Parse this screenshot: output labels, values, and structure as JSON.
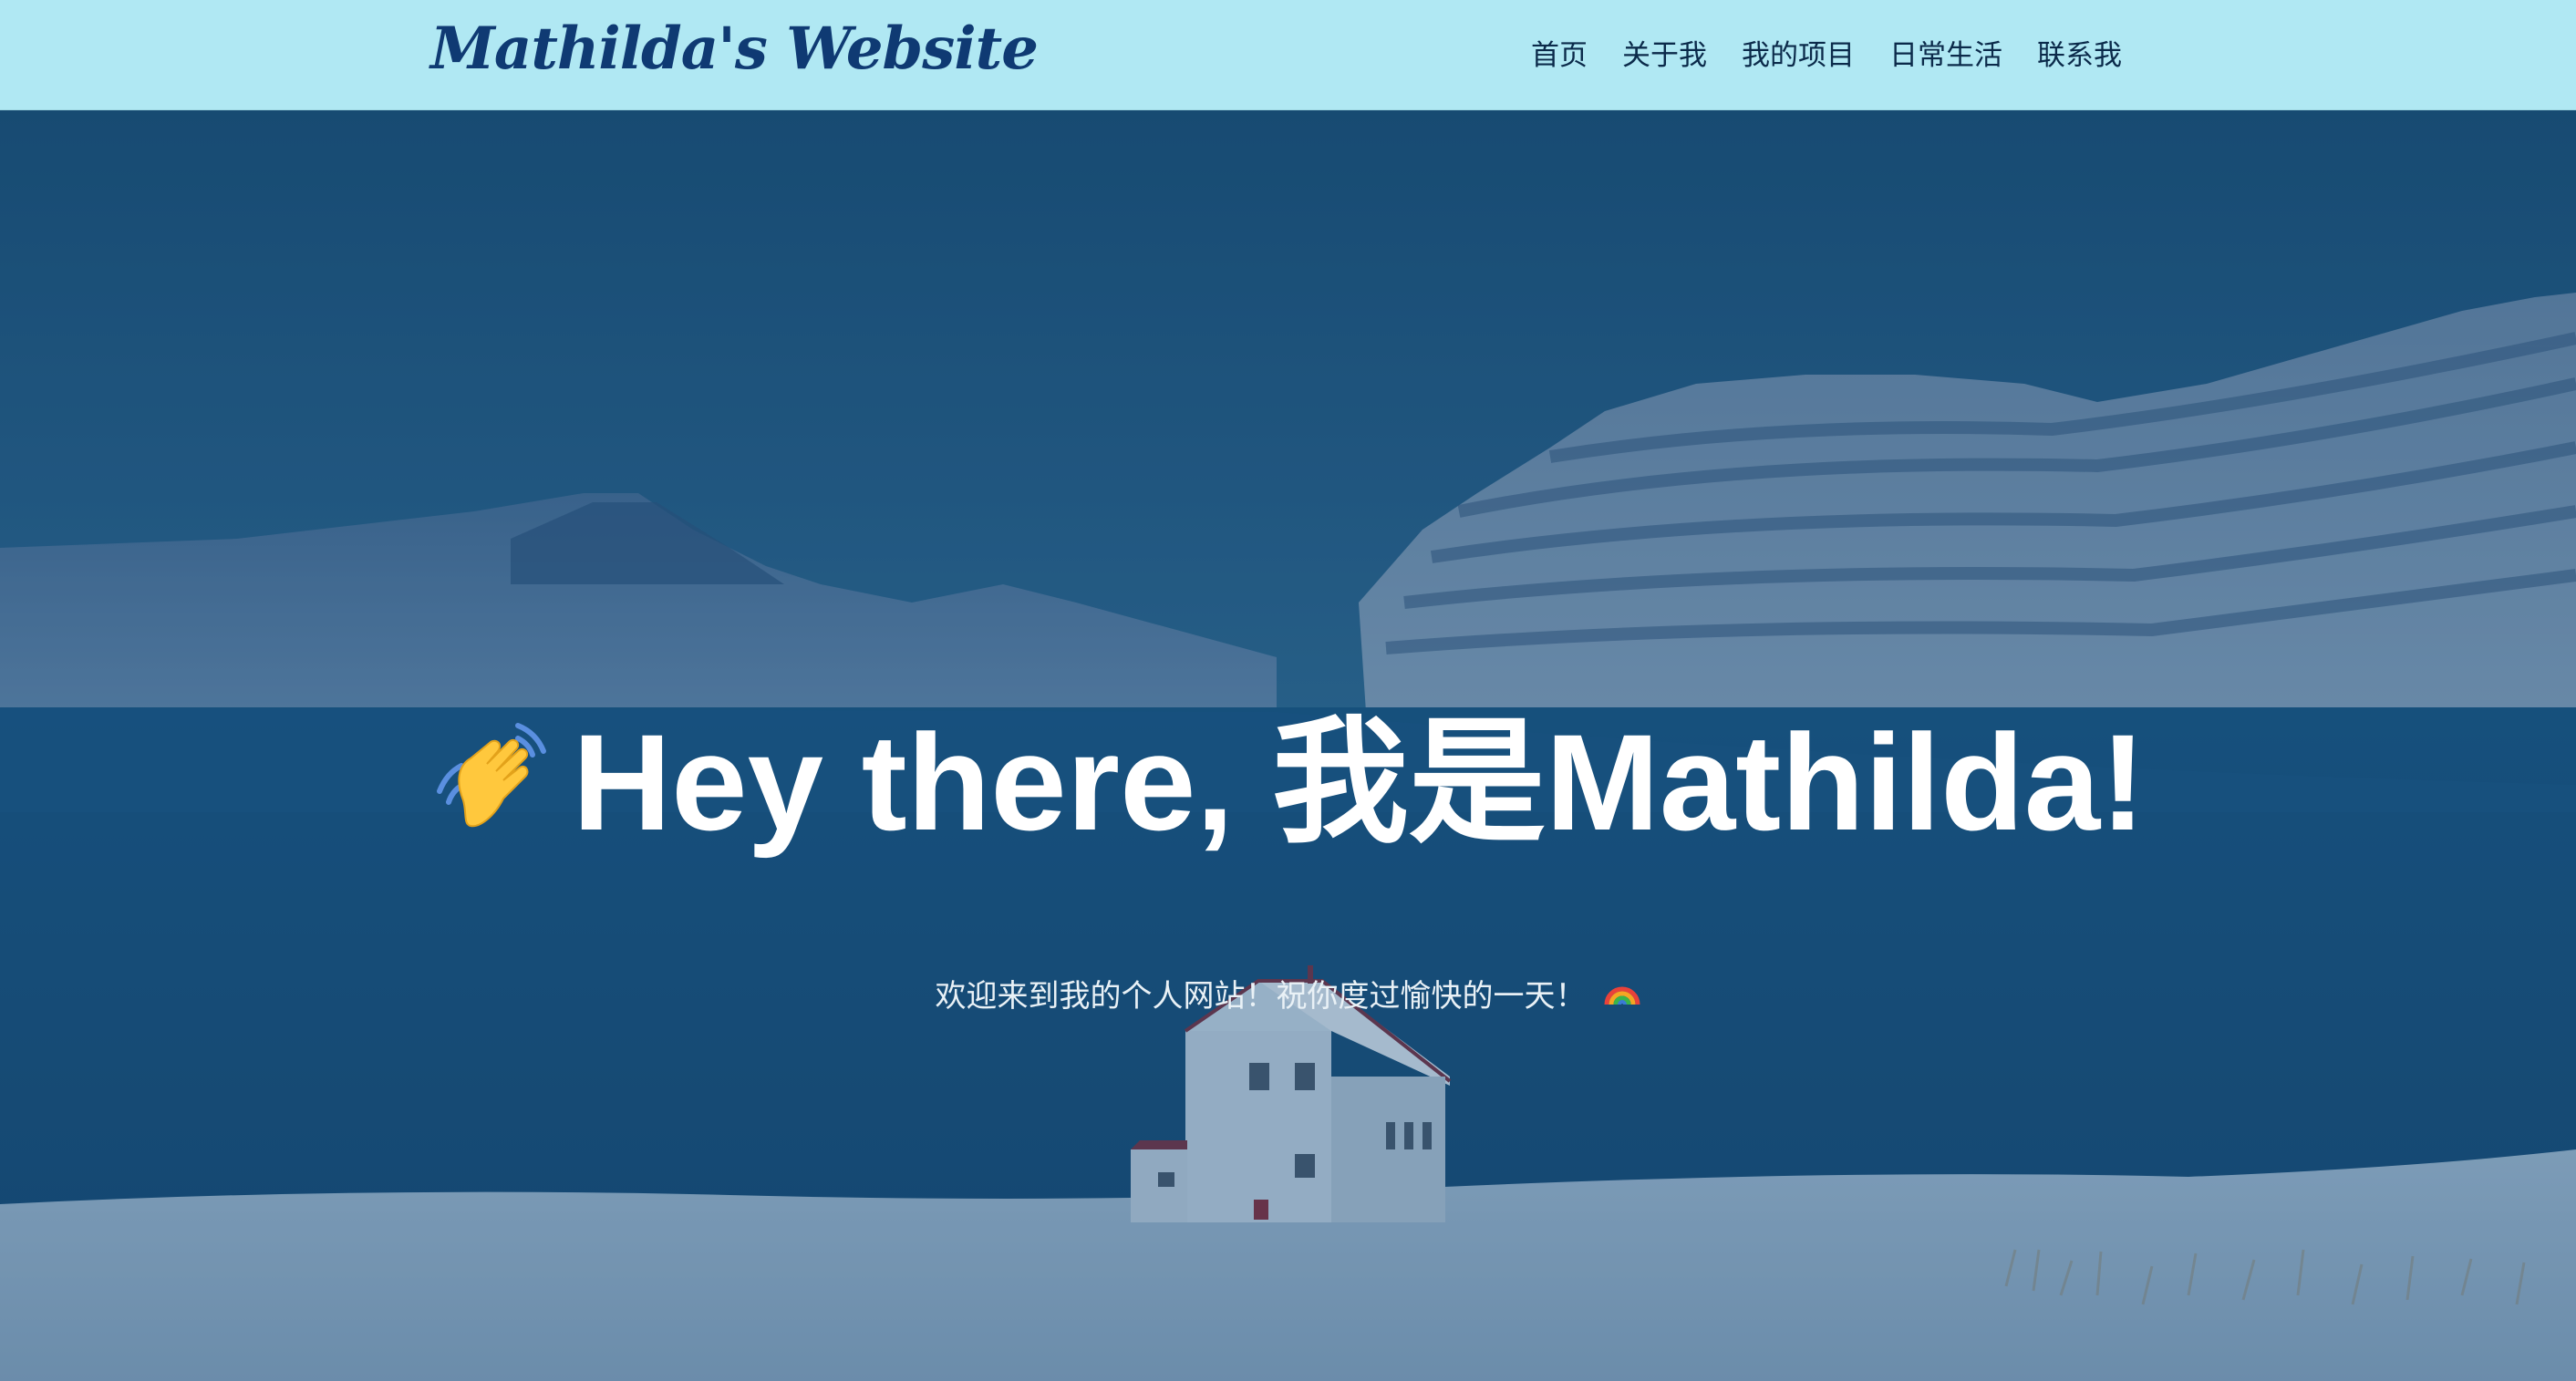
{
  "navbar": {
    "brand": "Mathilda's Website",
    "links": [
      {
        "label": "首页"
      },
      {
        "label": "关于我"
      },
      {
        "label": "我的项目"
      },
      {
        "label": "日常生活"
      },
      {
        "label": "联系我"
      }
    ],
    "background": "#b0e8f3",
    "brand_color": "#0f3a73"
  },
  "hero": {
    "icon": "waving-hand-icon",
    "title": "Hey there, 我是Mathilda!",
    "subtitle": "欢迎来到我的个人网站！祝你度过愉快的一天！",
    "subtitle_icon": "rainbow-icon",
    "background_image": "snowy fjord landscape with white house",
    "overlay_color": "#124a7a"
  }
}
